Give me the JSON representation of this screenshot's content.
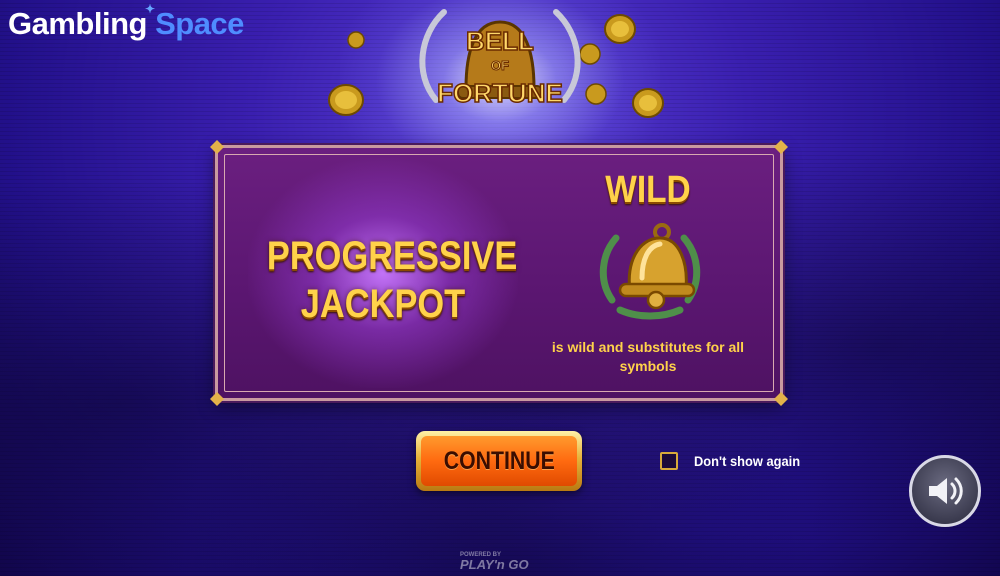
{
  "brand": {
    "name_part1": "Gambling",
    "name_part2": "Space"
  },
  "game": {
    "logo_line1": "BELL",
    "logo_line2": "OF",
    "logo_line3": "FORTUNE"
  },
  "panel": {
    "feature_line1": "PROGRESSIVE",
    "feature_line2": "JACKPOT",
    "wild_title": "WILD",
    "wild_icon": "bell-icon",
    "wild_description": "is wild and substitutes for all symbols"
  },
  "controls": {
    "continue_label": "CONTINUE",
    "dont_show_again_label": "Don't show again",
    "dont_show_again_checked": false,
    "sound_icon": "speaker-icon"
  },
  "footer": {
    "powered_by": "POWERED BY",
    "provider": "PLAY'n GO"
  },
  "colors": {
    "accent_gold": "#ffd24a",
    "panel_purple": "#6b1f80",
    "button_orange": "#ff6a10",
    "background_blue": "#3a1fb0"
  }
}
